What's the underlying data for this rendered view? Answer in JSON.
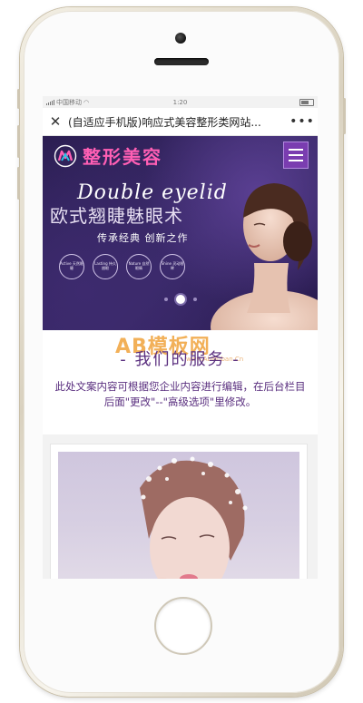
{
  "status_bar": {
    "carrier": "中国移动",
    "time": "1:20",
    "battery": ""
  },
  "nav_bar": {
    "close_icon": "close-icon",
    "title": "(自适应手机版)响应式美容整形类网站...",
    "more": "•••"
  },
  "header": {
    "logo_text": "整形美容",
    "menu_icon": "hamburger-icon"
  },
  "hero": {
    "script_title": "Double eyelid",
    "cn_title": "欧式翘睫魅眼术",
    "slogan": "传承经典 创新之作",
    "badges": [
      {
        "label": "Active\n天然眼睫"
      },
      {
        "label": "Lasting\n持久翘眼"
      },
      {
        "label": "Nature\n自然眼睛"
      },
      {
        "label": "Shine\n灵动眼眸"
      }
    ],
    "slides": 3,
    "active_slide": 2
  },
  "services": {
    "title": "- 我们的服务 -",
    "description": "此处文案内容可根据您企业内容进行编辑，在后台栏目后面\"更改\"--\"高级选项\"里修改。"
  },
  "watermark": {
    "text": "AB模板网",
    "sub": "www.AbMuban.Cn"
  },
  "colors": {
    "hero_bg": "#2b1e52",
    "logo_pink": "#ff5fb4",
    "menu_purple": "#7a3db0",
    "section_purple": "#5a2f7f",
    "phone_gold": "#d9d1bf"
  }
}
